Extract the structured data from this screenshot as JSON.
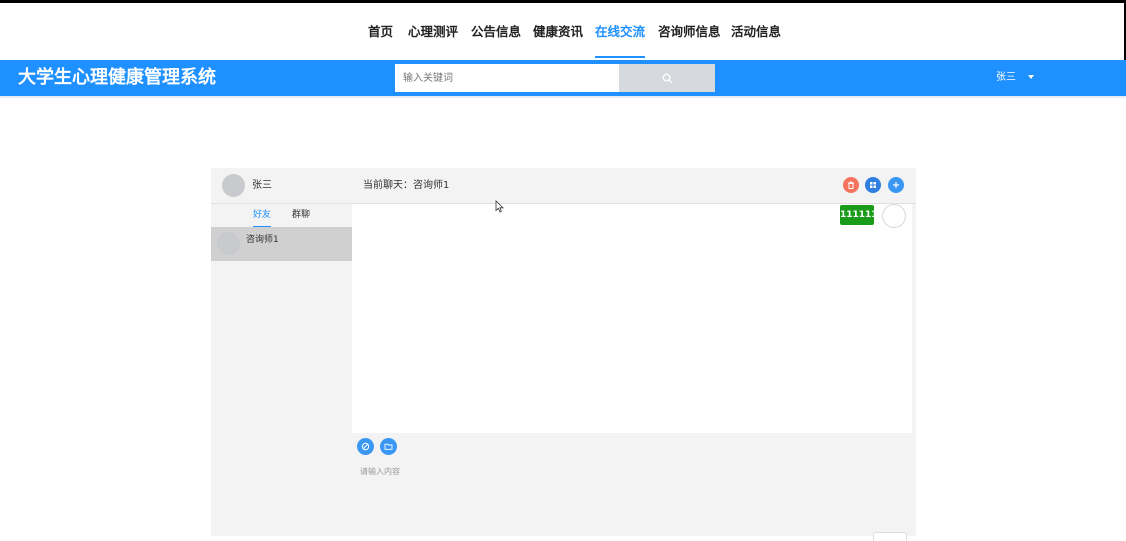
{
  "nav": {
    "items": [
      {
        "label": "首页"
      },
      {
        "label": "心理测评"
      },
      {
        "label": "公告信息"
      },
      {
        "label": "健康资讯"
      },
      {
        "label": "在线交流"
      },
      {
        "label": "咨询师信息"
      },
      {
        "label": "活动信息"
      }
    ],
    "active": "在线交流",
    "accent_color": "#1e90ff"
  },
  "header": {
    "site_title": "大学生心理健康管理系统",
    "search_placeholder": "输入关键词",
    "search_icon": "search-icon",
    "user_name": "张三",
    "user_caret_icon": "caret-down-icon",
    "bar_color": "#1e90ff"
  },
  "chat": {
    "me": {
      "name": "张三"
    },
    "current_chat": "当前聊天：咨询师1",
    "header_buttons": [
      {
        "icon": "delete-icon",
        "color": "#f5735f"
      },
      {
        "icon": "grid-icon",
        "color": "#2e7fe0"
      },
      {
        "icon": "plus-icon",
        "color": "#3a97f3"
      }
    ],
    "tabs": [
      {
        "label": "好友"
      },
      {
        "label": "群聊"
      }
    ],
    "active_tab": "好友",
    "friends": [
      {
        "name": "咨询师1"
      }
    ],
    "messages": [
      {
        "text": "111111",
        "color": "#1a9b1a"
      }
    ],
    "tools": [
      {
        "icon": "emoji-icon"
      },
      {
        "icon": "folder-icon"
      }
    ],
    "input_placeholder": "请输入内容"
  }
}
